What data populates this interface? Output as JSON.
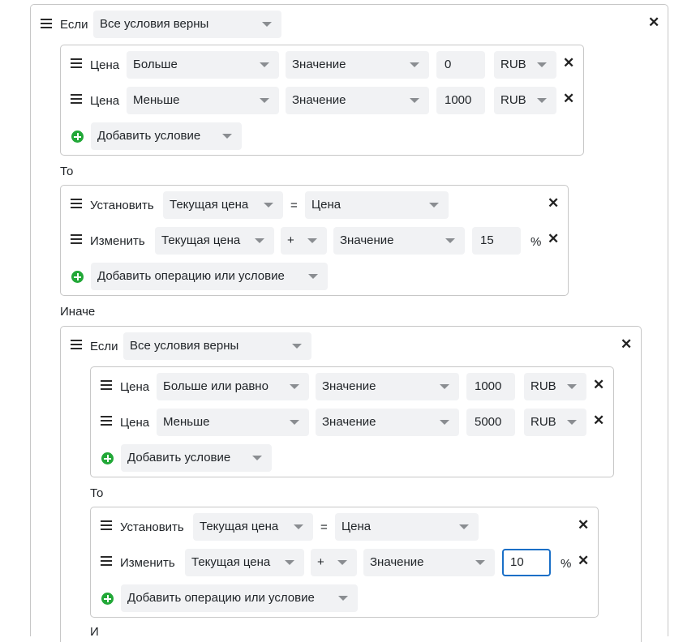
{
  "labels": {
    "if": "Если",
    "then": "То",
    "else": "Иначе",
    "price": "Цена",
    "set": "Установить",
    "change": "Изменить",
    "equals": "=",
    "percent": "%",
    "close": "✕"
  },
  "rule": {
    "match": "Все условия верны",
    "conditions": [
      {
        "field": "Цена",
        "operator": "Больше",
        "source": "Значение",
        "value": "0",
        "currency": "RUB"
      },
      {
        "field": "Цена",
        "operator": "Меньше",
        "source": "Значение",
        "value": "1000",
        "currency": "RUB"
      }
    ],
    "add_condition": "Добавить условие",
    "then": [
      {
        "action": "Установить",
        "target": "Текущая цена",
        "op": "=",
        "source": "Цена"
      },
      {
        "action": "Изменить",
        "target": "Текущая цена",
        "op": "+",
        "source": "Значение",
        "value": "15",
        "unit": "%"
      }
    ],
    "add_operation": "Добавить операцию или условие",
    "else_rule": {
      "match": "Все условия верны",
      "conditions": [
        {
          "field": "Цена",
          "operator": "Больше или равно",
          "source": "Значение",
          "value": "1000",
          "currency": "RUB"
        },
        {
          "field": "Цена",
          "operator": "Меньше",
          "source": "Значение",
          "value": "5000",
          "currency": "RUB"
        }
      ],
      "add_condition": "Добавить условие",
      "then": [
        {
          "action": "Установить",
          "target": "Текущая цена",
          "op": "=",
          "source": "Цена"
        },
        {
          "action": "Изменить",
          "target": "Текущая цена",
          "op": "+",
          "source": "Значение",
          "value": "10",
          "unit": "%"
        }
      ],
      "add_operation": "Добавить операцию или условие",
      "else_label_partial": "И"
    }
  }
}
